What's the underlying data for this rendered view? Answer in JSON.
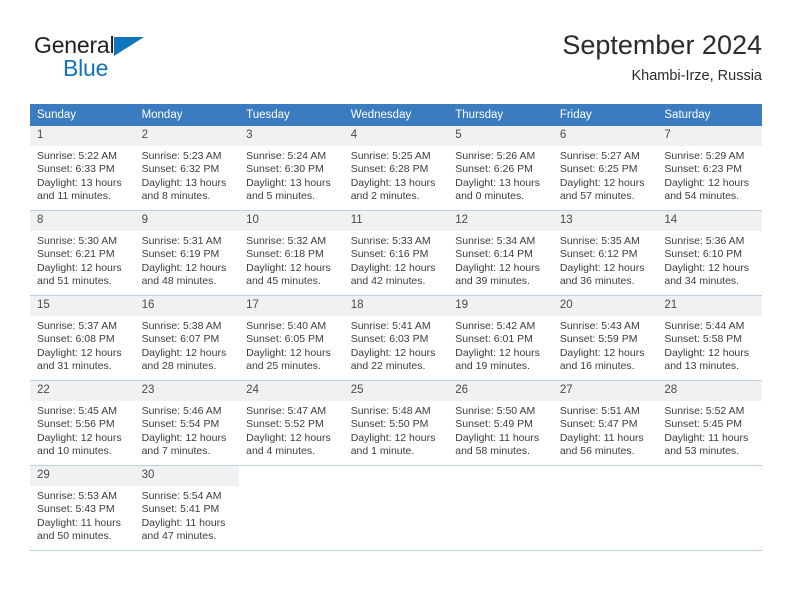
{
  "brand": {
    "name_part1": "General",
    "name_part2": "Blue",
    "triangle_color": "#1175bb",
    "text_color": "#231f20"
  },
  "header": {
    "title": "September 2024",
    "subtitle": "Khambi-Irze, Russia"
  },
  "theme": {
    "header_bg": "#3b7cc0",
    "header_text": "#ffffff",
    "daynum_bg": "#f1f1f1",
    "row_border": "#bcd0e6",
    "body_text": "#3c3c3c"
  },
  "weekday_headers": [
    "Sunday",
    "Monday",
    "Tuesday",
    "Wednesday",
    "Thursday",
    "Friday",
    "Saturday"
  ],
  "labels": {
    "sunrise_prefix": "Sunrise:",
    "sunset_prefix": "Sunset:",
    "daylight_prefix": "Daylight:"
  },
  "weeks": [
    [
      {
        "day": "1",
        "sunrise": "Sunrise: 5:22 AM",
        "sunset": "Sunset: 6:33 PM",
        "daylight": "Daylight: 13 hours and 11 minutes."
      },
      {
        "day": "2",
        "sunrise": "Sunrise: 5:23 AM",
        "sunset": "Sunset: 6:32 PM",
        "daylight": "Daylight: 13 hours and 8 minutes."
      },
      {
        "day": "3",
        "sunrise": "Sunrise: 5:24 AM",
        "sunset": "Sunset: 6:30 PM",
        "daylight": "Daylight: 13 hours and 5 minutes."
      },
      {
        "day": "4",
        "sunrise": "Sunrise: 5:25 AM",
        "sunset": "Sunset: 6:28 PM",
        "daylight": "Daylight: 13 hours and 2 minutes."
      },
      {
        "day": "5",
        "sunrise": "Sunrise: 5:26 AM",
        "sunset": "Sunset: 6:26 PM",
        "daylight": "Daylight: 13 hours and 0 minutes."
      },
      {
        "day": "6",
        "sunrise": "Sunrise: 5:27 AM",
        "sunset": "Sunset: 6:25 PM",
        "daylight": "Daylight: 12 hours and 57 minutes."
      },
      {
        "day": "7",
        "sunrise": "Sunrise: 5:29 AM",
        "sunset": "Sunset: 6:23 PM",
        "daylight": "Daylight: 12 hours and 54 minutes."
      }
    ],
    [
      {
        "day": "8",
        "sunrise": "Sunrise: 5:30 AM",
        "sunset": "Sunset: 6:21 PM",
        "daylight": "Daylight: 12 hours and 51 minutes."
      },
      {
        "day": "9",
        "sunrise": "Sunrise: 5:31 AM",
        "sunset": "Sunset: 6:19 PM",
        "daylight": "Daylight: 12 hours and 48 minutes."
      },
      {
        "day": "10",
        "sunrise": "Sunrise: 5:32 AM",
        "sunset": "Sunset: 6:18 PM",
        "daylight": "Daylight: 12 hours and 45 minutes."
      },
      {
        "day": "11",
        "sunrise": "Sunrise: 5:33 AM",
        "sunset": "Sunset: 6:16 PM",
        "daylight": "Daylight: 12 hours and 42 minutes."
      },
      {
        "day": "12",
        "sunrise": "Sunrise: 5:34 AM",
        "sunset": "Sunset: 6:14 PM",
        "daylight": "Daylight: 12 hours and 39 minutes."
      },
      {
        "day": "13",
        "sunrise": "Sunrise: 5:35 AM",
        "sunset": "Sunset: 6:12 PM",
        "daylight": "Daylight: 12 hours and 36 minutes."
      },
      {
        "day": "14",
        "sunrise": "Sunrise: 5:36 AM",
        "sunset": "Sunset: 6:10 PM",
        "daylight": "Daylight: 12 hours and 34 minutes."
      }
    ],
    [
      {
        "day": "15",
        "sunrise": "Sunrise: 5:37 AM",
        "sunset": "Sunset: 6:08 PM",
        "daylight": "Daylight: 12 hours and 31 minutes."
      },
      {
        "day": "16",
        "sunrise": "Sunrise: 5:38 AM",
        "sunset": "Sunset: 6:07 PM",
        "daylight": "Daylight: 12 hours and 28 minutes."
      },
      {
        "day": "17",
        "sunrise": "Sunrise: 5:40 AM",
        "sunset": "Sunset: 6:05 PM",
        "daylight": "Daylight: 12 hours and 25 minutes."
      },
      {
        "day": "18",
        "sunrise": "Sunrise: 5:41 AM",
        "sunset": "Sunset: 6:03 PM",
        "daylight": "Daylight: 12 hours and 22 minutes."
      },
      {
        "day": "19",
        "sunrise": "Sunrise: 5:42 AM",
        "sunset": "Sunset: 6:01 PM",
        "daylight": "Daylight: 12 hours and 19 minutes."
      },
      {
        "day": "20",
        "sunrise": "Sunrise: 5:43 AM",
        "sunset": "Sunset: 5:59 PM",
        "daylight": "Daylight: 12 hours and 16 minutes."
      },
      {
        "day": "21",
        "sunrise": "Sunrise: 5:44 AM",
        "sunset": "Sunset: 5:58 PM",
        "daylight": "Daylight: 12 hours and 13 minutes."
      }
    ],
    [
      {
        "day": "22",
        "sunrise": "Sunrise: 5:45 AM",
        "sunset": "Sunset: 5:56 PM",
        "daylight": "Daylight: 12 hours and 10 minutes."
      },
      {
        "day": "23",
        "sunrise": "Sunrise: 5:46 AM",
        "sunset": "Sunset: 5:54 PM",
        "daylight": "Daylight: 12 hours and 7 minutes."
      },
      {
        "day": "24",
        "sunrise": "Sunrise: 5:47 AM",
        "sunset": "Sunset: 5:52 PM",
        "daylight": "Daylight: 12 hours and 4 minutes."
      },
      {
        "day": "25",
        "sunrise": "Sunrise: 5:48 AM",
        "sunset": "Sunset: 5:50 PM",
        "daylight": "Daylight: 12 hours and 1 minute."
      },
      {
        "day": "26",
        "sunrise": "Sunrise: 5:50 AM",
        "sunset": "Sunset: 5:49 PM",
        "daylight": "Daylight: 11 hours and 58 minutes."
      },
      {
        "day": "27",
        "sunrise": "Sunrise: 5:51 AM",
        "sunset": "Sunset: 5:47 PM",
        "daylight": "Daylight: 11 hours and 56 minutes."
      },
      {
        "day": "28",
        "sunrise": "Sunrise: 5:52 AM",
        "sunset": "Sunset: 5:45 PM",
        "daylight": "Daylight: 11 hours and 53 minutes."
      }
    ],
    [
      {
        "day": "29",
        "sunrise": "Sunrise: 5:53 AM",
        "sunset": "Sunset: 5:43 PM",
        "daylight": "Daylight: 11 hours and 50 minutes."
      },
      {
        "day": "30",
        "sunrise": "Sunrise: 5:54 AM",
        "sunset": "Sunset: 5:41 PM",
        "daylight": "Daylight: 11 hours and 47 minutes."
      },
      {
        "day": "",
        "sunrise": "",
        "sunset": "",
        "daylight": ""
      },
      {
        "day": "",
        "sunrise": "",
        "sunset": "",
        "daylight": ""
      },
      {
        "day": "",
        "sunrise": "",
        "sunset": "",
        "daylight": ""
      },
      {
        "day": "",
        "sunrise": "",
        "sunset": "",
        "daylight": ""
      },
      {
        "day": "",
        "sunrise": "",
        "sunset": "",
        "daylight": ""
      }
    ]
  ]
}
